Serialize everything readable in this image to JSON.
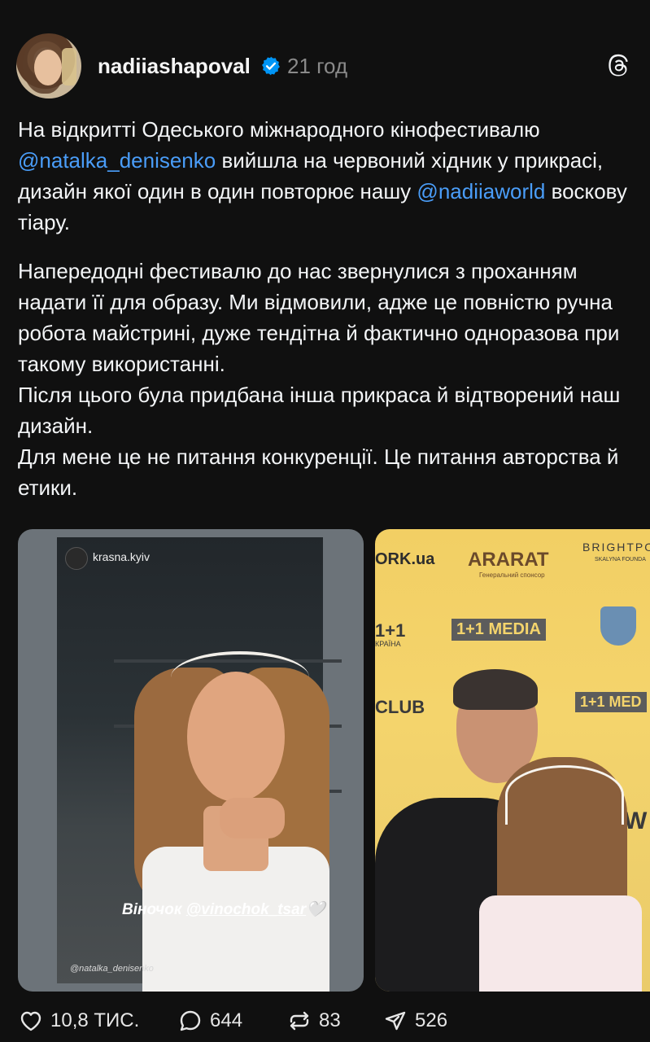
{
  "post": {
    "username": "nadiiashapoval",
    "time": "21 год",
    "paragraph1": {
      "t1": "На відкритті Одеського міжнародного кінофестивалю ",
      "mention1": "@natalka_denisenko",
      "t2": " вийшла на червоний хідник у прикрасі, дизайн якої один в один повторює нашу ",
      "mention2": "@nadiiaworld",
      "t3": " воскову тіару."
    },
    "paragraph2": "Напередодні фестивалю до нас звернулися з проханням надати її для образу. Ми відмовили, адже це повністю ручна робота майстрині, дуже тендітна й фактично одноразова при такому використанні.",
    "paragraph3": "Після цього була придбана інша прикраса й відтворений наш дизайн.",
    "paragraph4": "Для мене це не питання конкуренції. Це питання авторства й етики."
  },
  "media1": {
    "story_user": "krasna.kyiv",
    "caption_prefix": "Віночок ",
    "caption_tag": "@vinochok_tsar",
    "caption_suffix": "🤍",
    "mention": "@natalka_denisenko"
  },
  "media2": {
    "sponsor1": "ORK.ua",
    "sponsor2": "ARARAT",
    "sponsor2_sub": "Генеральний спонсор",
    "sponsor3": "BRIGHTPO",
    "sponsor3_sub": "SKALYNA FOUNDA",
    "sponsor4": "1+1",
    "sponsor4_sub": "КРАЇНА",
    "sponsor5": "1+1 MEDIA",
    "sponsor6": "CLUB",
    "sponsor7": "1+1 MED",
    "sponsor8": "W"
  },
  "actions": {
    "likes": "10,8 ТИС.",
    "comments": "644",
    "reposts": "83",
    "shares": "526"
  },
  "colors": {
    "background": "#101010",
    "mention": "#4a9df8",
    "verified": "#0095f6"
  }
}
